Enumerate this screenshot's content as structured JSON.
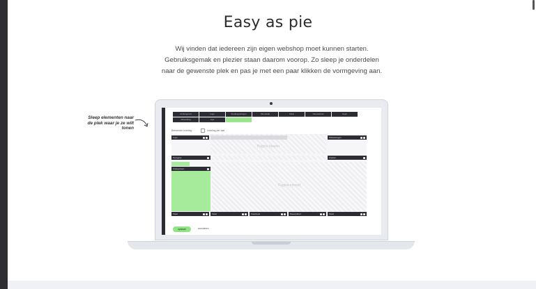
{
  "heading": "Easy as pie",
  "intro": {
    "line1": "Wij vinden dat iedereen zijn eigen webshop moet kunnen starten.",
    "line2": "Gebruiksgemak en plezier staan daarom voorop. Zo sleep je onderdelen",
    "line3": "naar de gewenste plek en pas je met een paar klikken de vormgeving aan."
  },
  "callout": {
    "line1": "Sleep elementen naar",
    "line2": "de plek waar je ze wilt",
    "line3": "tonen"
  },
  "editor": {
    "toolbar_row1": [
      "Achtergrond",
      "Logo",
      "Snelkoppelingen",
      "Menubalk",
      "Tekst",
      "Nieuwsbrief",
      "Zoek"
    ],
    "toolbar_row2": [
      "Afbeelding",
      "Lijst",
      ""
    ],
    "option_label": "Beheerder indeling",
    "option_checkbox_label": "Indeling per taal",
    "header_left": "Logo",
    "header_right": "Winkelwagen",
    "header_region": "Pagina header",
    "nav_left": "Navigatie",
    "nav_right": "Zoeken",
    "side_block": "Categorieen",
    "content_region": "Pagina inhoud",
    "footer_items": [
      "Tekst",
      "Tekst",
      "Facebook",
      "Nieuwsbrief",
      "Tekst"
    ],
    "save_label": "opslaan",
    "cancel_label": "annuleren"
  },
  "colors": {
    "accent_green": "#9be58f",
    "dark": "#2c2c34"
  }
}
